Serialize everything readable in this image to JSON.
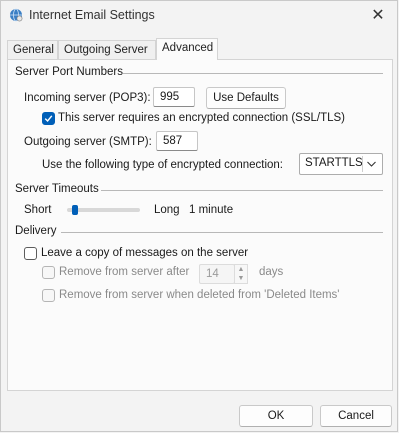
{
  "window": {
    "title": "Internet Email Settings",
    "close_glyph": "✕"
  },
  "tabs": [
    {
      "label": "General",
      "active": false
    },
    {
      "label": "Outgoing Server",
      "active": false
    },
    {
      "label": "Advanced",
      "active": true
    }
  ],
  "server_ports": {
    "heading": "Server Port Numbers",
    "incoming_label": "Incoming server (POP3):",
    "incoming_value": "995",
    "use_defaults_label": "Use Defaults",
    "ssl_label": "This server requires an encrypted connection (SSL/TLS)",
    "ssl_checked": true,
    "outgoing_label": "Outgoing server (SMTP):",
    "outgoing_value": "587",
    "encryption_label": "Use the following type of encrypted connection:",
    "encryption_value": "STARTTLS"
  },
  "timeouts": {
    "heading": "Server Timeouts",
    "short_label": "Short",
    "long_label": "Long",
    "value_label": "1 minute",
    "slider_fraction": 0.08
  },
  "delivery": {
    "heading": "Delivery",
    "leave_copy_label": "Leave a copy of messages on the server",
    "leave_copy_checked": false,
    "remove_after_label": "Remove from server after",
    "remove_after_days": "14",
    "days_label": "days",
    "remove_deleted_label": "Remove from server when deleted from 'Deleted Items'"
  },
  "footer": {
    "ok_label": "OK",
    "cancel_label": "Cancel"
  },
  "colors": {
    "accent": "#005fb8",
    "background": "#f3f3f3",
    "panel": "#fbfbfb"
  }
}
